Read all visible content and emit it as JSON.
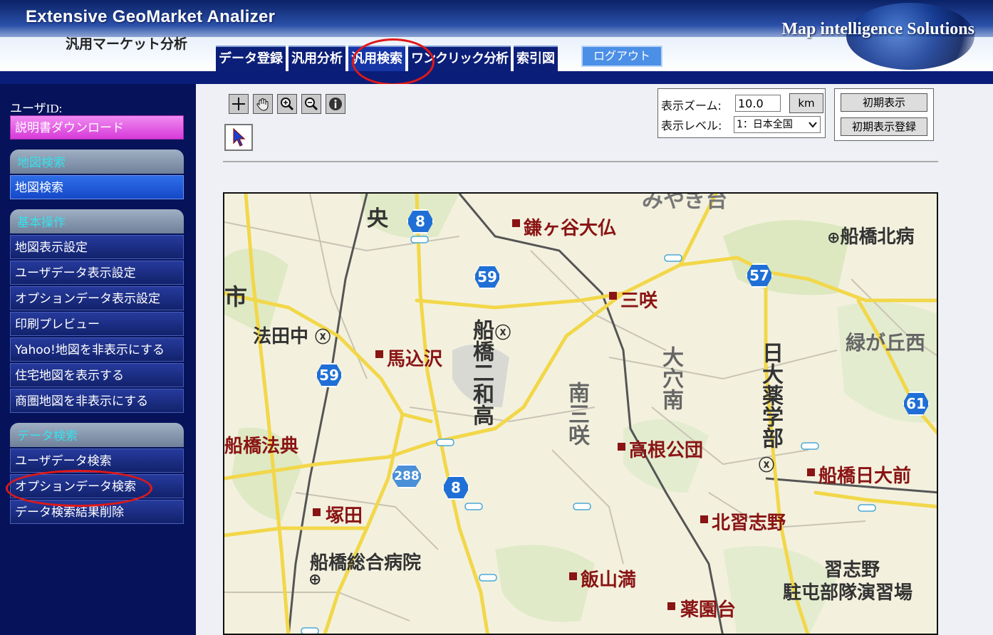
{
  "header": {
    "app_title": "Extensive GeoMarket Analizer",
    "app_subtitle": "汎用マーケット分析",
    "brand": "Map intelligence Solutions",
    "tabs": [
      {
        "label": "データ登録"
      },
      {
        "label": "汎用分析"
      },
      {
        "label": "汎用検索"
      },
      {
        "label": "ワンクリック分析"
      },
      {
        "label": "索引図"
      }
    ],
    "logout": "ログアウト"
  },
  "sidebar": {
    "user_id_label": "ユーザID:",
    "manual_download": "説明書ダウンロード",
    "sections": {
      "map_search": {
        "title": "地図検索",
        "items": [
          "地図検索"
        ]
      },
      "basic": {
        "title": "基本操作",
        "items": [
          "地図表示設定",
          "ユーザデータ表示設定",
          "オプションデータ表示設定",
          "印刷プレビュー",
          "Yahoo!地図を非表示にする",
          "住宅地図を表示する",
          "商圏地図を非表示にする"
        ]
      },
      "data_search": {
        "title": "データ検索",
        "items": [
          "ユーザデータ検索",
          "オプションデータ検索",
          "データ検索結果削除"
        ]
      }
    }
  },
  "toolbar": {
    "icons": [
      "crosshair-icon",
      "pan-hand-icon",
      "zoom-in-icon",
      "zoom-out-icon",
      "info-icon",
      "select-arrow-icon"
    ],
    "zoom_label": "表示ズーム:",
    "zoom_value": "10.0",
    "zoom_unit": "km",
    "level_label": "表示レベル:",
    "level_value": "1：日本全国",
    "initial_view": "初期表示",
    "initial_view_register": "初期表示登録"
  },
  "map": {
    "place_labels": {
      "kamagaya_daibutsu": "鎌ヶ谷大仏",
      "funabashi_kita_byo": "船橋北病",
      "sakiku": "三咲",
      "midorigaoka": "緑が丘西",
      "houdenaka": "法田中",
      "magomezawa": "馬込沢",
      "funabashi_hoten": "船橋法典",
      "takane_koudan": "高根公団",
      "funabashi_nichidai": "船橋日大前",
      "tsukada": "塚田",
      "kitanarashino": "北習志野",
      "funabashi_sogo": "船橋総合病院",
      "iiyamamitsu": "飯山満",
      "narashino": "習志野",
      "chuton_enshujo": "駐屯部隊演習場",
      "yakuendai": "薬園台",
      "chuo": "央",
      "ichi": "市",
      "miyagidai": "みやぎ台",
      "funabashi_wako": "船橋二和高",
      "minami_sakiku": "南三咲",
      "oana_minami": "大穴南",
      "nichidai_yakugakubu": "日大薬学部"
    },
    "route_shields": [
      "8",
      "59",
      "57",
      "59",
      "61",
      "288",
      "8"
    ]
  },
  "colors": {
    "header_band": "#0a1d78",
    "sidebar_bg": "#06135a",
    "manual_btn": "#d63ad8",
    "section_head_text": "#38e0ea",
    "poi_red": "#8a1414",
    "route_shield": "#1f6fd6",
    "highlight_circle": "#e01818"
  }
}
